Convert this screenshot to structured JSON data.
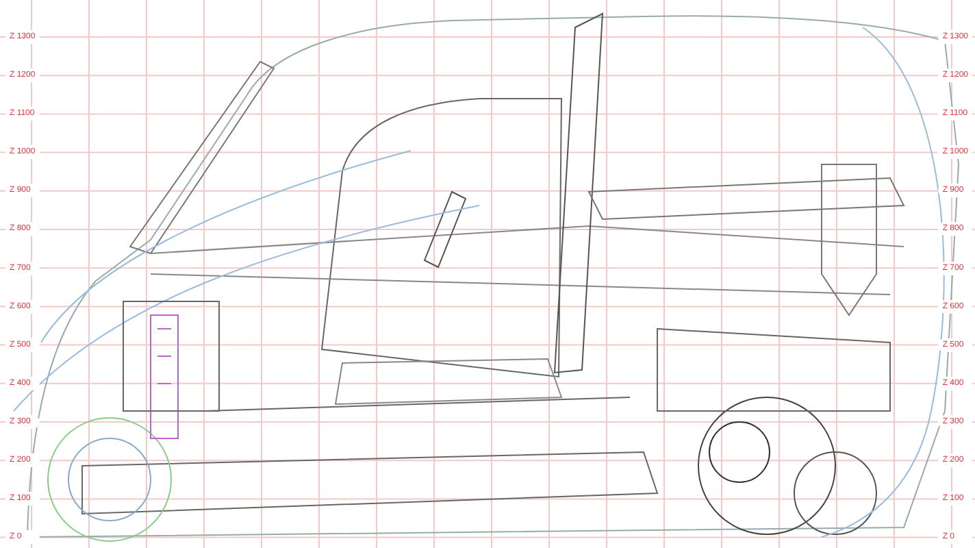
{
  "left_scale": {
    "labels": [
      "Z 1300",
      "Z 1200",
      "Z 1100",
      "Z 1000",
      "Z 900",
      "Z 800",
      "Z 700",
      "Z 600",
      "Z 500",
      "Z 400",
      "Z 300",
      "Z 200",
      "Z 100",
      "Z 0"
    ]
  },
  "right_scale": {
    "labels": [
      "Z 1300",
      "Z 1200",
      "Z 1100",
      "Z 1000",
      "Z 900",
      "Z 800",
      "Z 700",
      "Z 600",
      "Z 500",
      "Z 400",
      "Z 300",
      "Z 200",
      "Z 100",
      "Z 0"
    ]
  }
}
